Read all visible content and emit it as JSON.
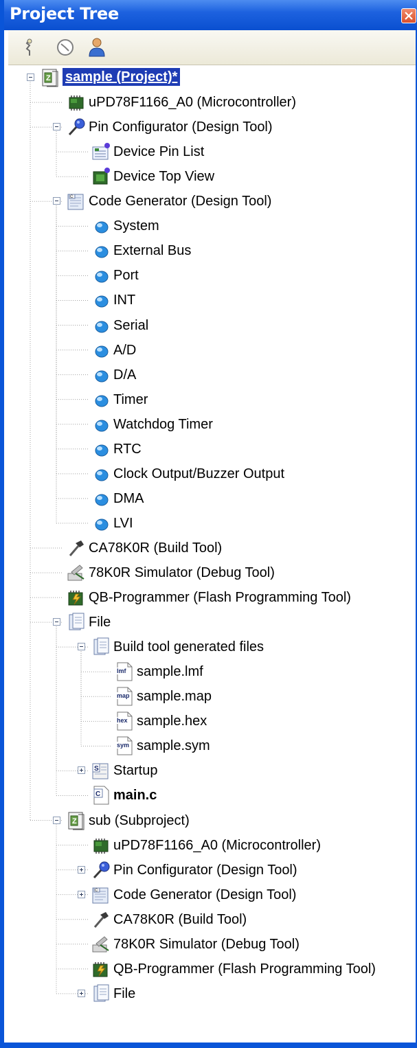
{
  "window": {
    "title": "Project Tree",
    "colors": {
      "titlebar": "#0a55d8",
      "close": "#d9502c",
      "selection": "#1e3cb4"
    }
  },
  "toolbar": {
    "buttons": [
      {
        "name": "property-icon"
      },
      {
        "name": "clock-icon"
      },
      {
        "name": "user-icon"
      }
    ]
  },
  "tree": {
    "rows": [
      {
        "label": "sample (Project)*",
        "icon": "project-icon",
        "expander": "minus",
        "selected": true
      },
      {
        "label": "uPD78F1166_A0 (Microcontroller)",
        "icon": "microcontroller-icon"
      },
      {
        "label": "Pin Configurator (Design Tool)",
        "icon": "pin-configurator-icon",
        "expander": "minus"
      },
      {
        "label": "Device Pin List",
        "icon": "device-pin-list-icon"
      },
      {
        "label": "Device Top View",
        "icon": "device-top-view-icon"
      },
      {
        "label": "Code Generator (Design Tool)",
        "icon": "code-generator-icon",
        "expander": "minus"
      },
      {
        "label": "System",
        "icon": "peripheral-icon"
      },
      {
        "label": "External Bus",
        "icon": "peripheral-icon"
      },
      {
        "label": "Port",
        "icon": "peripheral-icon"
      },
      {
        "label": "INT",
        "icon": "peripheral-icon"
      },
      {
        "label": "Serial",
        "icon": "peripheral-icon"
      },
      {
        "label": "A/D",
        "icon": "peripheral-icon"
      },
      {
        "label": "D/A",
        "icon": "peripheral-icon"
      },
      {
        "label": "Timer",
        "icon": "peripheral-icon"
      },
      {
        "label": "Watchdog Timer",
        "icon": "peripheral-icon"
      },
      {
        "label": "RTC",
        "icon": "peripheral-icon"
      },
      {
        "label": "Clock Output/Buzzer Output",
        "icon": "peripheral-icon"
      },
      {
        "label": "DMA",
        "icon": "peripheral-icon"
      },
      {
        "label": "LVI",
        "icon": "peripheral-icon"
      },
      {
        "label": "CA78K0R (Build Tool)",
        "icon": "build-tool-icon"
      },
      {
        "label": "78K0R Simulator (Debug Tool)",
        "icon": "debug-tool-icon"
      },
      {
        "label": "QB-Programmer (Flash Programming Tool)",
        "icon": "flash-programming-icon"
      },
      {
        "label": "File",
        "icon": "file-folder-icon",
        "expander": "minus"
      },
      {
        "label": "Build tool generated files",
        "icon": "generated-files-icon",
        "expander": "minus"
      },
      {
        "label": "sample.lmf",
        "icon": "lmf-file-icon",
        "badge": "lmf"
      },
      {
        "label": "sample.map",
        "icon": "map-file-icon",
        "badge": "map"
      },
      {
        "label": "sample.hex",
        "icon": "hex-file-icon",
        "badge": "hex"
      },
      {
        "label": "sample.sym",
        "icon": "sym-file-icon",
        "badge": "sym"
      },
      {
        "label": "Startup",
        "icon": "startup-folder-icon",
        "expander": "plus",
        "badge": "S"
      },
      {
        "label": "main.c",
        "icon": "c-source-file-icon",
        "bold": true,
        "badge": "C"
      },
      {
        "label": "sub (Subproject)",
        "icon": "subproject-icon",
        "expander": "minus"
      },
      {
        "label": "uPD78F1166_A0 (Microcontroller)",
        "icon": "microcontroller-icon"
      },
      {
        "label": "Pin Configurator (Design Tool)",
        "icon": "pin-configurator-icon",
        "expander": "plus"
      },
      {
        "label": "Code Generator (Design Tool)",
        "icon": "code-generator-icon",
        "expander": "plus"
      },
      {
        "label": "CA78K0R (Build Tool)",
        "icon": "build-tool-icon"
      },
      {
        "label": "78K0R Simulator (Debug Tool)",
        "icon": "debug-tool-icon"
      },
      {
        "label": "QB-Programmer (Flash Programming Tool)",
        "icon": "flash-programming-icon"
      },
      {
        "label": "File",
        "icon": "file-folder-icon",
        "expander": "plus"
      }
    ]
  }
}
